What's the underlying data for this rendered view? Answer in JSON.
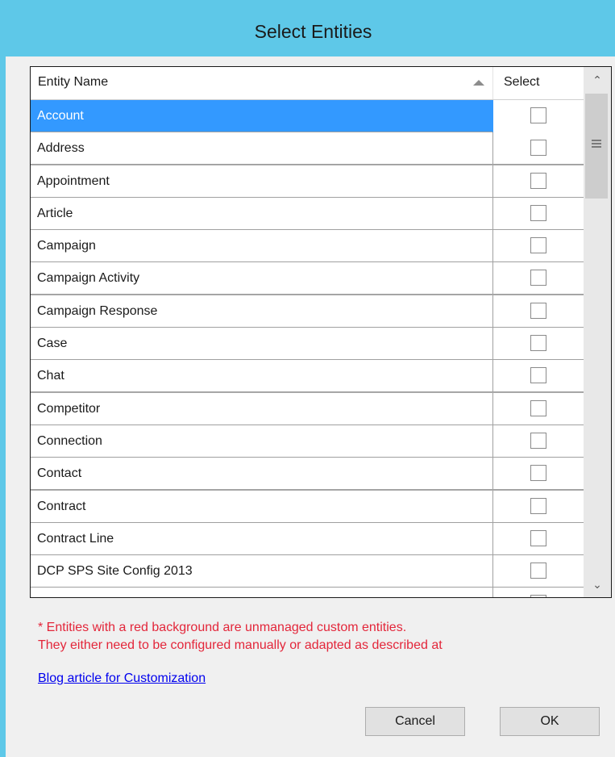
{
  "window": {
    "title": "Select Entities"
  },
  "grid": {
    "columns": {
      "name": "Entity Name",
      "select": "Select"
    },
    "rows": [
      {
        "name": "Account",
        "selected": true
      },
      {
        "name": "Address"
      },
      {
        "name": "Appointment"
      },
      {
        "name": "Article"
      },
      {
        "name": "Campaign"
      },
      {
        "name": "Campaign Activity"
      },
      {
        "name": "Campaign Response"
      },
      {
        "name": "Case"
      },
      {
        "name": "Chat"
      },
      {
        "name": "Competitor"
      },
      {
        "name": "Connection"
      },
      {
        "name": "Contact"
      },
      {
        "name": "Contract"
      },
      {
        "name": "Contract Line"
      },
      {
        "name": "DCP SPS Site Config 2013"
      }
    ]
  },
  "note": {
    "line1": "* Entities with a red background are unmanaged custom entities.",
    "line2": "They either need to be  configured manually or adapted as described at"
  },
  "link": {
    "label": "Blog article for Customization"
  },
  "buttons": {
    "cancel": "Cancel",
    "ok": "OK"
  },
  "colors": {
    "title_bar": "#5ec8e8",
    "selected_row": "#3399ff",
    "note_text": "#e3263a",
    "link": "#0000ee"
  }
}
